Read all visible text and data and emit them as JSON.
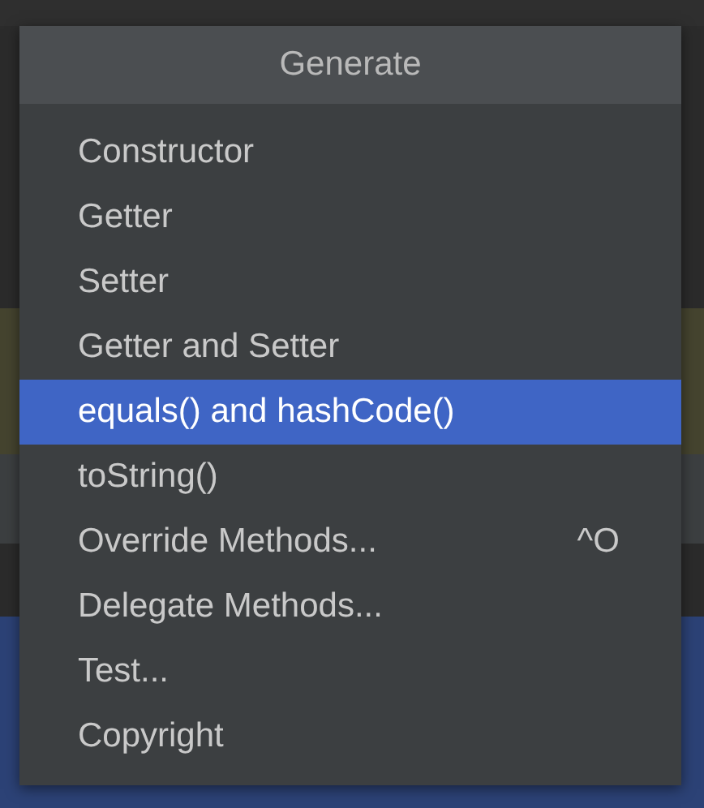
{
  "popup": {
    "title": "Generate",
    "items": [
      {
        "label": "Constructor",
        "selected": false
      },
      {
        "label": "Getter",
        "selected": false
      },
      {
        "label": "Setter",
        "selected": false
      },
      {
        "label": "Getter and Setter",
        "selected": false
      },
      {
        "label": "equals() and hashCode()",
        "selected": true
      },
      {
        "label": "toString()",
        "selected": false
      },
      {
        "label": "Override Methods...",
        "shortcut": "^O",
        "selected": false
      },
      {
        "label": "Delegate Methods...",
        "selected": false
      },
      {
        "label": "Test...",
        "selected": false
      },
      {
        "label": "Copyright",
        "selected": false
      }
    ]
  }
}
